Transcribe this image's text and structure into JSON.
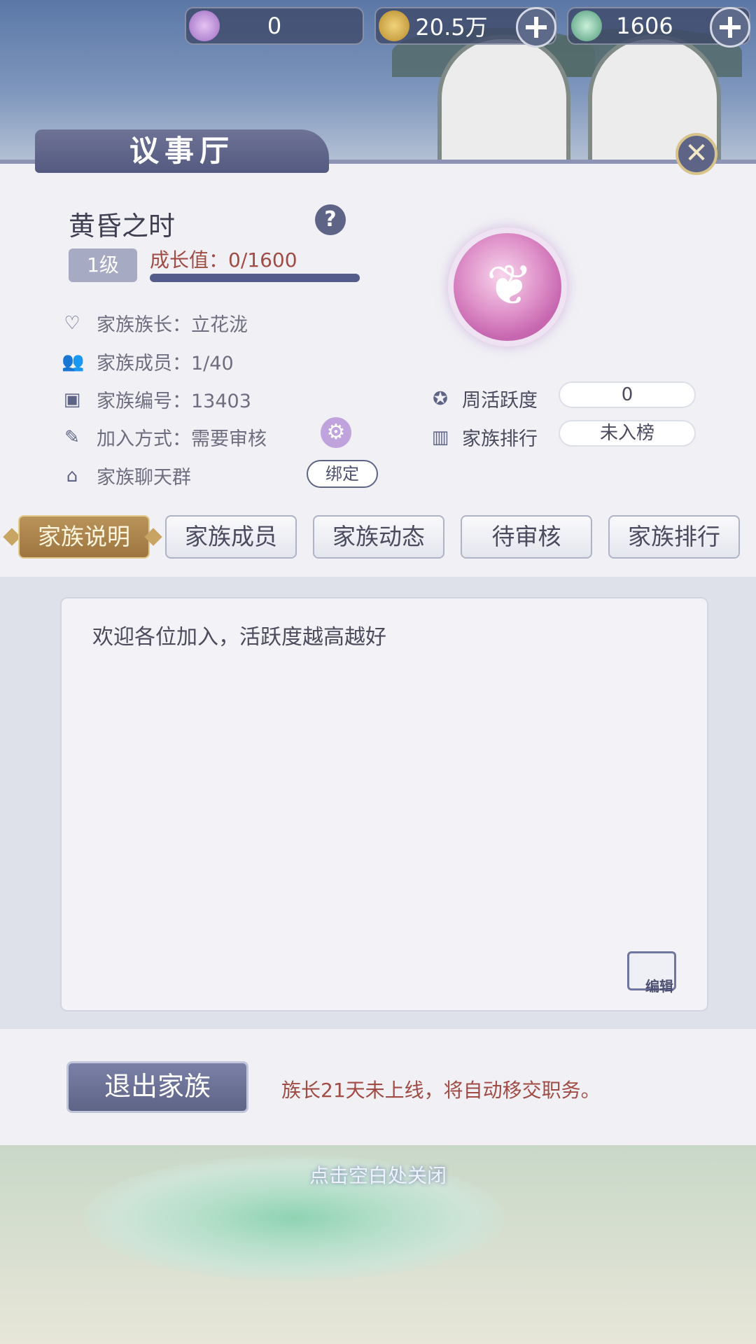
{
  "currencies": [
    {
      "icon": "purple-gem-icon",
      "value": "0",
      "has_plus": false
    },
    {
      "icon": "gold-coin-icon",
      "value": "20.5万",
      "has_plus": true
    },
    {
      "icon": "jade-token-icon",
      "value": "1606",
      "has_plus": true
    }
  ],
  "panel": {
    "title": "议事厅",
    "close_icon": "close-icon"
  },
  "family": {
    "name": "黄昏之时",
    "level_label": "1级",
    "growth_label": "成长值：0/1600",
    "growth_current": 0,
    "growth_max": 1600,
    "leader": "家族族长：立花泷",
    "members": "家族成员：1/40",
    "id": "家族编号：13403",
    "join_mode": "加入方式：需要审核",
    "chat_group": "家族聊天群",
    "bind_label": "绑定",
    "weekly_activity_label": "周活跃度",
    "weekly_activity_value": "0",
    "ranking_label": "家族排行",
    "ranking_value": "未入榜"
  },
  "tabs": [
    {
      "label": "家族说明",
      "active": true
    },
    {
      "label": "家族成员",
      "active": false
    },
    {
      "label": "家族动态",
      "active": false
    },
    {
      "label": "待审核",
      "active": false
    },
    {
      "label": "家族排行",
      "active": false
    }
  ],
  "description": {
    "text": "欢迎各位加入，活跃度越高越好",
    "edit_label": "编辑"
  },
  "footer": {
    "exit_label": "退出家族",
    "notice": "族长21天未上线，将自动移交职务。"
  },
  "tap_to_close": "点击空白处关闭",
  "colors": {
    "accent": "#5e6486",
    "tab_active": "#b08449",
    "warning_text": "#a04c44"
  }
}
